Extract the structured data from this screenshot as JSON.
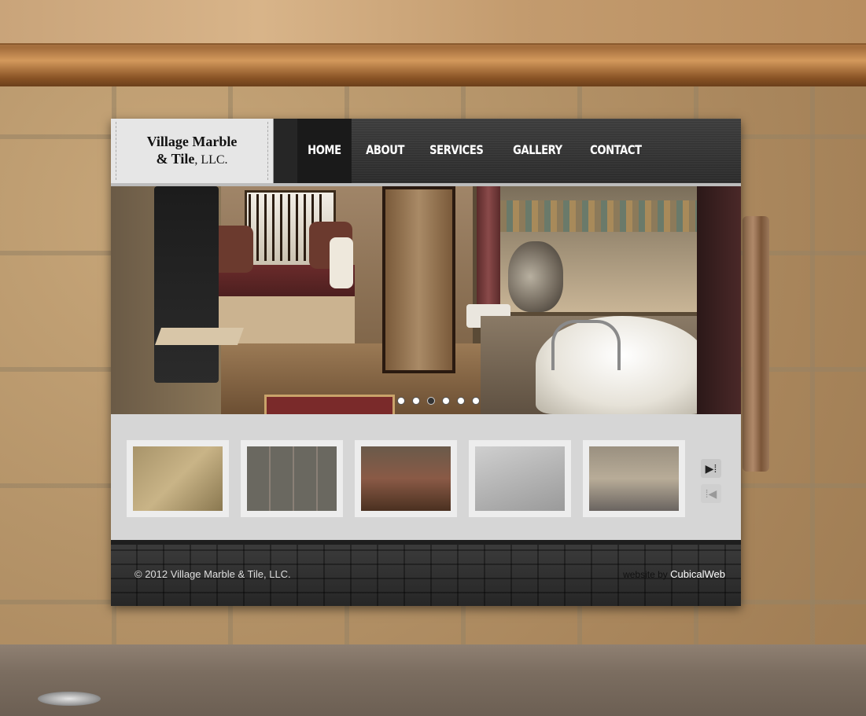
{
  "logo": {
    "line1": "Village Marble",
    "line2_bold": "& Tile",
    "line2_rest": ", LLC."
  },
  "nav": {
    "items": [
      {
        "label": "HOME",
        "active": true
      },
      {
        "label": "ABOUT"
      },
      {
        "label": "SERVICES"
      },
      {
        "label": "GALLERY"
      },
      {
        "label": "CONTACT"
      }
    ]
  },
  "slider": {
    "dot_count": 6,
    "active_index": 2
  },
  "thumbnails": {
    "items": [
      {
        "name": "thumb-shower-tile"
      },
      {
        "name": "thumb-stone-floor"
      },
      {
        "name": "thumb-glass-shower"
      },
      {
        "name": "thumb-shower-base"
      },
      {
        "name": "thumb-pebble-floor"
      }
    ],
    "next_icon": "play-next-icon",
    "prev_icon": "play-prev-icon"
  },
  "footer": {
    "copyright": "© 2012 Village Marble & Tile, LLC.",
    "credit_prefix": "website by",
    "credit_link": "CubicalWeb"
  }
}
